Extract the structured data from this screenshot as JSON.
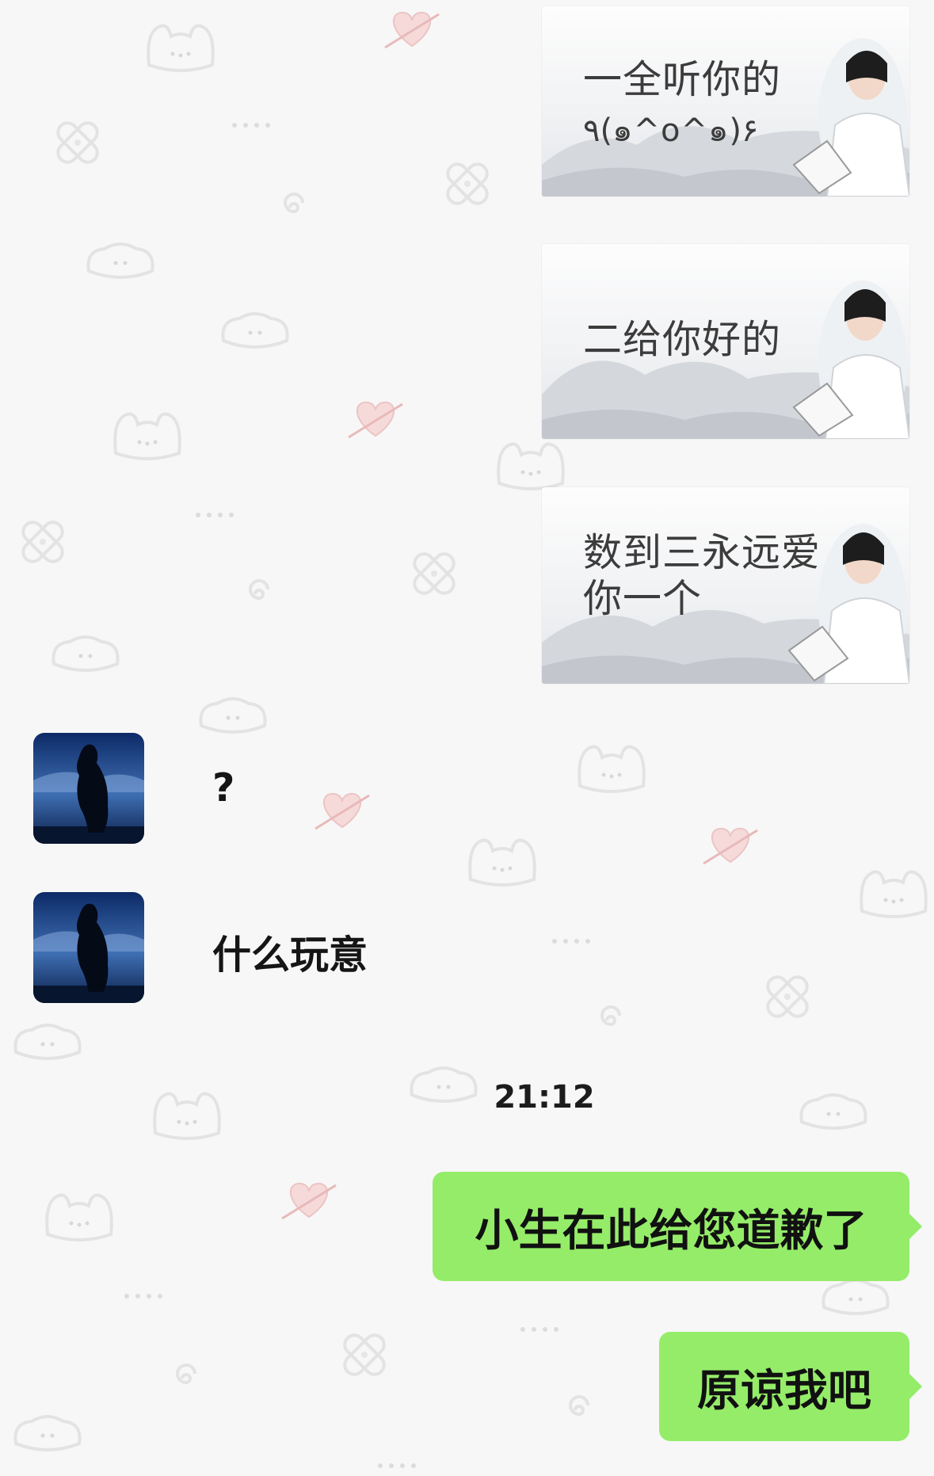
{
  "colors": {
    "background": "#f7f7f7",
    "outgoing_bubble": "#95ec69",
    "text": "#151515"
  },
  "stickers": [
    {
      "line1": "一全听你的",
      "line2": "٩(๑^o^๑)۶"
    },
    {
      "line1": "二给你好的",
      "line2": ""
    },
    {
      "line1": "数到三永远爱",
      "line2": "你一个"
    }
  ],
  "incoming": [
    {
      "text": "?",
      "avatar": "silhouette-avatar"
    },
    {
      "text": "什么玩意",
      "avatar": "silhouette-avatar"
    }
  ],
  "timestamp": "21:12",
  "outgoing": [
    {
      "text": "小生在此给您道歉了"
    },
    {
      "text": "原谅我吧"
    }
  ]
}
